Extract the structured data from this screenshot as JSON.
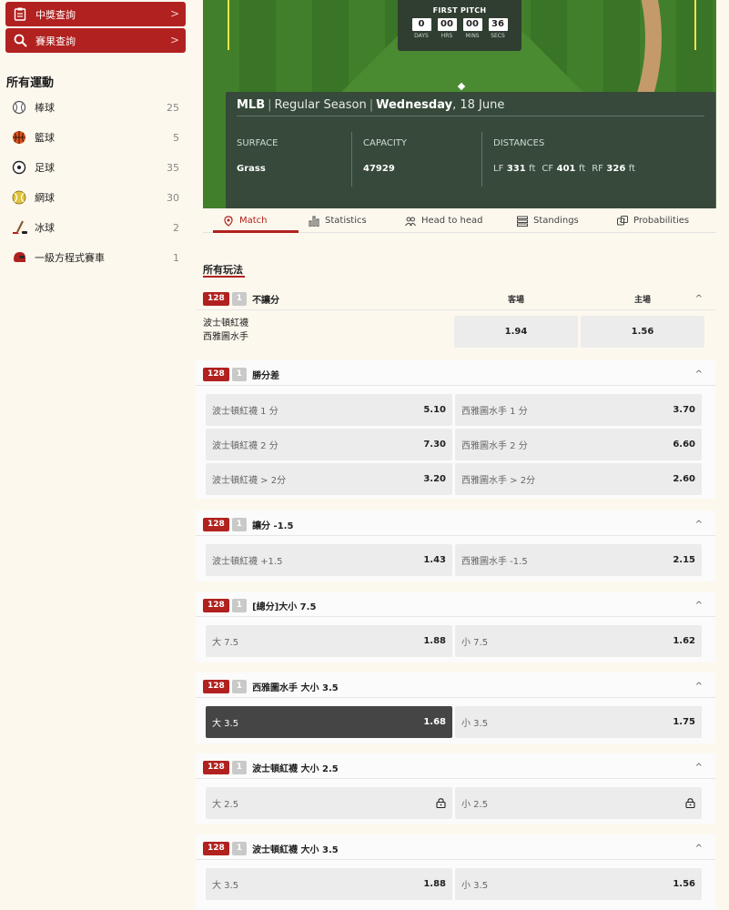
{
  "sidebar": {
    "buttons": [
      {
        "label": "中獎查詢",
        "icon": "clipboard-icon"
      },
      {
        "label": "賽果查詢",
        "icon": "search-icon"
      }
    ],
    "title": "所有運動",
    "sports": [
      {
        "name": "棒球",
        "count": "25",
        "icon": "baseball-icon"
      },
      {
        "name": "籃球",
        "count": "5",
        "icon": "basketball-icon"
      },
      {
        "name": "足球",
        "count": "35",
        "icon": "soccer-icon"
      },
      {
        "name": "網球",
        "count": "30",
        "icon": "tennis-icon"
      },
      {
        "name": "冰球",
        "count": "2",
        "icon": "hockey-icon"
      },
      {
        "name": "一級方程式賽車",
        "count": "1",
        "icon": "racing-helmet-icon"
      }
    ]
  },
  "hero": {
    "countdown_title": "FIRST PITCH",
    "countdown": [
      {
        "value": "0",
        "label": "DAYS"
      },
      {
        "value": "00",
        "label": "HRS"
      },
      {
        "value": "00",
        "label": "MINS"
      },
      {
        "value": "36",
        "label": "SECS"
      }
    ],
    "league": "MLB",
    "season": "Regular Season",
    "weekday": "Wednesday",
    "date": ", 18 June",
    "surface_label": "SURFACE",
    "surface_value": "Grass",
    "capacity_label": "CAPACITY",
    "capacity_value": "47929",
    "distances_label": "DISTANCES",
    "distances": {
      "lf_label": "LF",
      "lf": "331",
      "cf_label": "CF",
      "cf": "401",
      "rf_label": "RF",
      "rf": "326",
      "unit": "ft"
    }
  },
  "tabs": [
    {
      "label": "Match",
      "icon": "location-icon"
    },
    {
      "label": "Statistics",
      "icon": "bar-chart-icon"
    },
    {
      "label": "Head to head",
      "icon": "users-icon"
    },
    {
      "label": "Standings",
      "icon": "list-icon"
    },
    {
      "label": "Probabilities",
      "icon": "dice-icon"
    }
  ],
  "all_markets_title": "所有玩法",
  "markets": {
    "moneyline": {
      "count": "128",
      "num": "1",
      "name": "不讓分",
      "away_label": "客場",
      "home_label": "主場",
      "team_away": "波士頓紅襪",
      "team_home": "西雅圖水手",
      "away_odd": "1.94",
      "home_odd": "1.56"
    },
    "margin": {
      "count": "128",
      "num": "1",
      "name": "勝分差",
      "rows": [
        {
          "left": "波士頓紅襪 1 分",
          "left_odd": "5.10",
          "right": "西雅圖水手 1 分",
          "right_odd": "3.70"
        },
        {
          "left": "波士頓紅襪 2 分",
          "left_odd": "7.30",
          "right": "西雅圖水手 2 分",
          "right_odd": "6.60"
        },
        {
          "left": "波士頓紅襪 > 2分",
          "left_odd": "3.20",
          "right": "西雅圖水手 > 2分",
          "right_odd": "2.60"
        }
      ]
    },
    "handicap": {
      "count": "128",
      "num": "1",
      "name": "讓分 -1.5",
      "left": "波士頓紅襪 +1.5",
      "left_odd": "1.43",
      "right": "西雅圖水手 -1.5",
      "right_odd": "2.15"
    },
    "total": {
      "count": "128",
      "num": "1",
      "name": "[總分]大小 7.5",
      "left": "大 7.5",
      "left_odd": "1.88",
      "right": "小 7.5",
      "right_odd": "1.62"
    },
    "sea_total": {
      "count": "128",
      "num": "1",
      "name": "西雅圖水手 大小 3.5",
      "left": "大 3.5",
      "left_odd": "1.68",
      "right": "小 3.5",
      "right_odd": "1.75"
    },
    "bos_total_25": {
      "count": "128",
      "num": "1",
      "name": "波士頓紅襪 大小 2.5",
      "left": "大 2.5",
      "right": "小 2.5"
    },
    "bos_total_35": {
      "count": "128",
      "num": "1",
      "name": "波士頓紅襪 大小 3.5",
      "left": "大 3.5",
      "left_odd": "1.88",
      "right": "小 3.5",
      "right_odd": "1.56"
    }
  }
}
